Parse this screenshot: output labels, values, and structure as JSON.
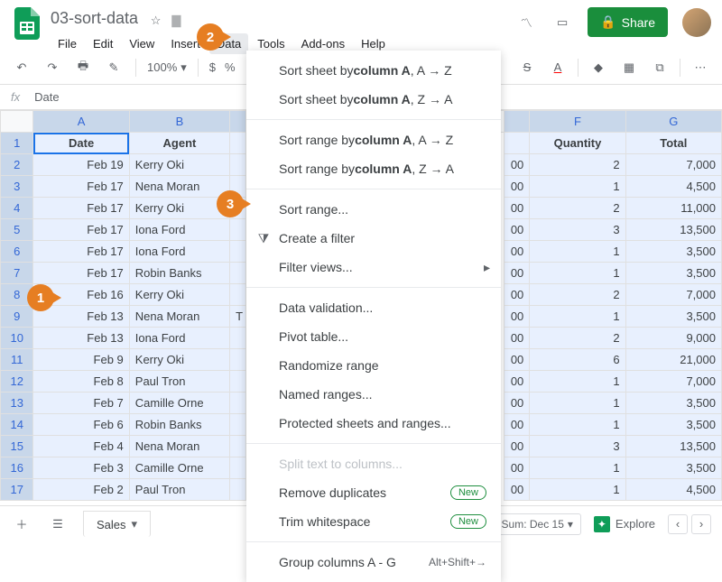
{
  "doc": {
    "title": "03-sort-data"
  },
  "menus": {
    "file": "File",
    "edit": "Edit",
    "view": "View",
    "insert": "Insert",
    "data": "Data",
    "tools": "Tools",
    "addons": "Add-ons",
    "help": "Help"
  },
  "share": "Share",
  "toolbar": {
    "zoom": "100%",
    "currency": "$",
    "percent": "%"
  },
  "formula": {
    "fx": "fx",
    "value": "Date"
  },
  "columns": {
    "A": "A",
    "B": "B",
    "F": "F",
    "G": "G"
  },
  "headers": {
    "date": "Date",
    "agent": "Agent",
    "qty": "Quantity",
    "total": "Total"
  },
  "rows": [
    {
      "n": 1
    },
    {
      "n": 2,
      "date": "Feb 19",
      "agent": "Kerry Oki",
      "epfx": "00",
      "qty": "2",
      "total": "7,000"
    },
    {
      "n": 3,
      "date": "Feb 17",
      "agent": "Nena Moran",
      "epfx": "00",
      "qty": "1",
      "total": "4,500"
    },
    {
      "n": 4,
      "date": "Feb 17",
      "agent": "Kerry Oki",
      "epfx": "00",
      "qty": "2",
      "total": "11,000"
    },
    {
      "n": 5,
      "date": "Feb 17",
      "agent": "Iona Ford",
      "epfx": "00",
      "qty": "3",
      "total": "13,500"
    },
    {
      "n": 6,
      "date": "Feb 17",
      "agent": "Iona Ford",
      "epfx": "00",
      "qty": "1",
      "total": "3,500"
    },
    {
      "n": 7,
      "date": "Feb 17",
      "agent": "Robin Banks",
      "epfx": "00",
      "qty": "1",
      "total": "3,500"
    },
    {
      "n": 8,
      "date": "Feb 16",
      "agent": "Kerry Oki",
      "epfx": "00",
      "qty": "2",
      "total": "7,000"
    },
    {
      "n": 9,
      "date": "Feb 13",
      "agent": "Nena Moran",
      "cpfx": "T",
      "epfx": "00",
      "qty": "1",
      "total": "3,500"
    },
    {
      "n": 10,
      "date": "Feb 13",
      "agent": "Iona Ford",
      "epfx": "00",
      "qty": "2",
      "total": "9,000"
    },
    {
      "n": 11,
      "date": "Feb 9",
      "agent": "Kerry Oki",
      "epfx": "00",
      "qty": "6",
      "total": "21,000"
    },
    {
      "n": 12,
      "date": "Feb 8",
      "agent": "Paul Tron",
      "epfx": "00",
      "qty": "1",
      "total": "7,000"
    },
    {
      "n": 13,
      "date": "Feb 7",
      "agent": "Camille Orne",
      "epfx": "00",
      "qty": "1",
      "total": "3,500"
    },
    {
      "n": 14,
      "date": "Feb 6",
      "agent": "Robin Banks",
      "epfx": "00",
      "qty": "1",
      "total": "3,500"
    },
    {
      "n": 15,
      "date": "Feb 4",
      "agent": "Nena Moran",
      "epfx": "00",
      "qty": "3",
      "total": "13,500"
    },
    {
      "n": 16,
      "date": "Feb 3",
      "agent": "Camille Orne",
      "epfx": "00",
      "qty": "1",
      "total": "3,500"
    },
    {
      "n": 17,
      "date": "Feb 2",
      "agent": "Paul Tron",
      "epfx": "00",
      "qty": "1",
      "total": "4,500"
    }
  ],
  "dropdown": {
    "sort_sheet_az_pre": "Sort sheet by ",
    "sort_sheet_az_b": "column A",
    "sort_sheet_az_post": ", A → Z",
    "sort_sheet_za_pre": "Sort sheet by ",
    "sort_sheet_za_b": "column A",
    "sort_sheet_za_post": ", Z → A",
    "sort_range_az_pre": "Sort range by ",
    "sort_range_az_b": "column A",
    "sort_range_az_post": ", A → Z",
    "sort_range_za_pre": "Sort range by ",
    "sort_range_za_b": "column A",
    "sort_range_za_post": ", Z → A",
    "sort_range": "Sort range...",
    "create_filter": "Create a filter",
    "filter_views": "Filter views...",
    "data_validation": "Data validation...",
    "pivot": "Pivot table...",
    "randomize": "Randomize range",
    "named": "Named ranges...",
    "protected": "Protected sheets and ranges...",
    "split": "Split text to columns...",
    "remove_dup": "Remove duplicates",
    "trim": "Trim whitespace",
    "group": "Group columns A - G",
    "group_hk": "Alt+Shift+→",
    "new": "New"
  },
  "bottom": {
    "tab": "Sales",
    "sum": "Sum: Dec 15",
    "explore": "Explore"
  },
  "callouts": {
    "c1": "1",
    "c2": "2",
    "c3": "3"
  }
}
